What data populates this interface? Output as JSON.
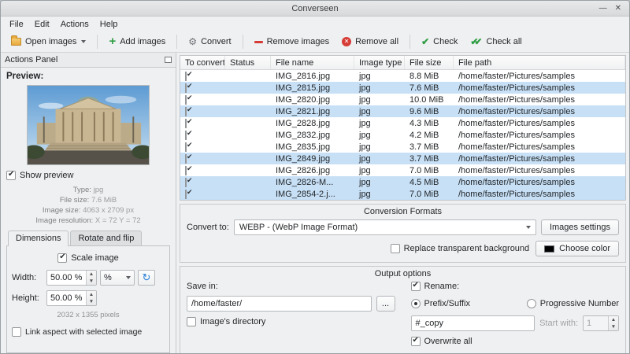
{
  "window": {
    "title": "Converseen",
    "minimize": "—",
    "close": "✕"
  },
  "menu": {
    "items": [
      "File",
      "Edit",
      "Actions",
      "Help"
    ]
  },
  "toolbar": {
    "open": "Open images",
    "add": "Add images",
    "convert": "Convert",
    "remove": "Remove images",
    "remove_all": "Remove all",
    "check": "Check",
    "check_all": "Check all",
    "remove_all_glyph": "✕",
    "check_glyph": "✔",
    "check_all_glyph": "✔✔",
    "gear_glyph": "⚙",
    "refresh_glyph": "↻"
  },
  "actions_panel": {
    "title": "Actions Panel",
    "preview_label": "Preview:",
    "show_preview": {
      "label": "Show preview",
      "checked": true
    },
    "info": [
      {
        "label": "Type:",
        "value": "jpg"
      },
      {
        "label": "File size:",
        "value": "7.6 MiB"
      },
      {
        "label": "Image size:",
        "value": "4063 x 2709 px"
      },
      {
        "label": "Image resolution:",
        "value": "X = 72 Y = 72"
      }
    ],
    "tabs": [
      {
        "label": "Dimensions"
      },
      {
        "label": "Rotate and flip"
      }
    ],
    "dimensions": {
      "scale_image": {
        "label": "Scale image",
        "checked": true
      },
      "width_label": "Width:",
      "width_value": "50.00 %",
      "height_label": "Height:",
      "height_value": "50.00 %",
      "unit": "%",
      "pixels_info": "2032 x 1355 pixels",
      "link_aspect": {
        "label": "Link aspect with selected image",
        "checked": false
      }
    }
  },
  "table": {
    "columns": [
      "To convert",
      "Status",
      "File name",
      "Image type",
      "File size",
      "File path"
    ],
    "rows": [
      {
        "checked": true,
        "status": "",
        "name": "IMG_2816.jpg",
        "type": "jpg",
        "size": "8.8 MiB",
        "path": "/home/faster/Pictures/samples",
        "selected": false
      },
      {
        "checked": true,
        "status": "",
        "name": "IMG_2815.jpg",
        "type": "jpg",
        "size": "7.6 MiB",
        "path": "/home/faster/Pictures/samples",
        "selected": true
      },
      {
        "checked": true,
        "status": "",
        "name": "IMG_2820.jpg",
        "type": "jpg",
        "size": "10.0 MiB",
        "path": "/home/faster/Pictures/samples",
        "selected": false
      },
      {
        "checked": true,
        "status": "",
        "name": "IMG_2821.jpg",
        "type": "jpg",
        "size": "9.6 MiB",
        "path": "/home/faster/Pictures/samples",
        "selected": true
      },
      {
        "checked": true,
        "status": "",
        "name": "IMG_2828.jpg",
        "type": "jpg",
        "size": "4.3 MiB",
        "path": "/home/faster/Pictures/samples",
        "selected": false
      },
      {
        "checked": true,
        "status": "",
        "name": "IMG_2832.jpg",
        "type": "jpg",
        "size": "4.2 MiB",
        "path": "/home/faster/Pictures/samples",
        "selected": false
      },
      {
        "checked": true,
        "status": "",
        "name": "IMG_2835.jpg",
        "type": "jpg",
        "size": "3.7 MiB",
        "path": "/home/faster/Pictures/samples",
        "selected": false
      },
      {
        "checked": true,
        "status": "",
        "name": "IMG_2849.jpg",
        "type": "jpg",
        "size": "3.7 MiB",
        "path": "/home/faster/Pictures/samples",
        "selected": true
      },
      {
        "checked": true,
        "status": "",
        "name": "IMG_2826.jpg",
        "type": "jpg",
        "size": "7.0 MiB",
        "path": "/home/faster/Pictures/samples",
        "selected": false
      },
      {
        "checked": true,
        "status": "",
        "name": "IMG_2826-M...",
        "type": "jpg",
        "size": "4.5 MiB",
        "path": "/home/faster/Pictures/samples",
        "selected": true
      },
      {
        "checked": true,
        "status": "",
        "name": "IMG_2854-2.j...",
        "type": "jpg",
        "size": "7.0 MiB",
        "path": "/home/faster/Pictures/samples",
        "selected": true
      }
    ]
  },
  "conversion": {
    "title": "Conversion Formats",
    "convert_to_label": "Convert to:",
    "format": "WEBP - (WebP Image Format)",
    "images_settings": "Images settings",
    "replace_transparent": {
      "label": "Replace transparent background",
      "checked": false
    },
    "choose_color": "Choose color"
  },
  "output": {
    "title": "Output options",
    "save_in_label": "Save in:",
    "save_path": "/home/faster/",
    "browse": "...",
    "images_directory": {
      "label": "Image's directory",
      "checked": false
    },
    "rename": {
      "label": "Rename:",
      "checked": true
    },
    "prefix_suffix": {
      "label": "Prefix/Suffix",
      "selected": true
    },
    "progressive_number": {
      "label": "Progressive Number",
      "selected": false
    },
    "rename_value": "#_copy",
    "start_with": {
      "label": "Start with:",
      "value": "1",
      "enabled": false
    },
    "overwrite_all": {
      "label": "Overwrite all",
      "checked": true
    }
  }
}
